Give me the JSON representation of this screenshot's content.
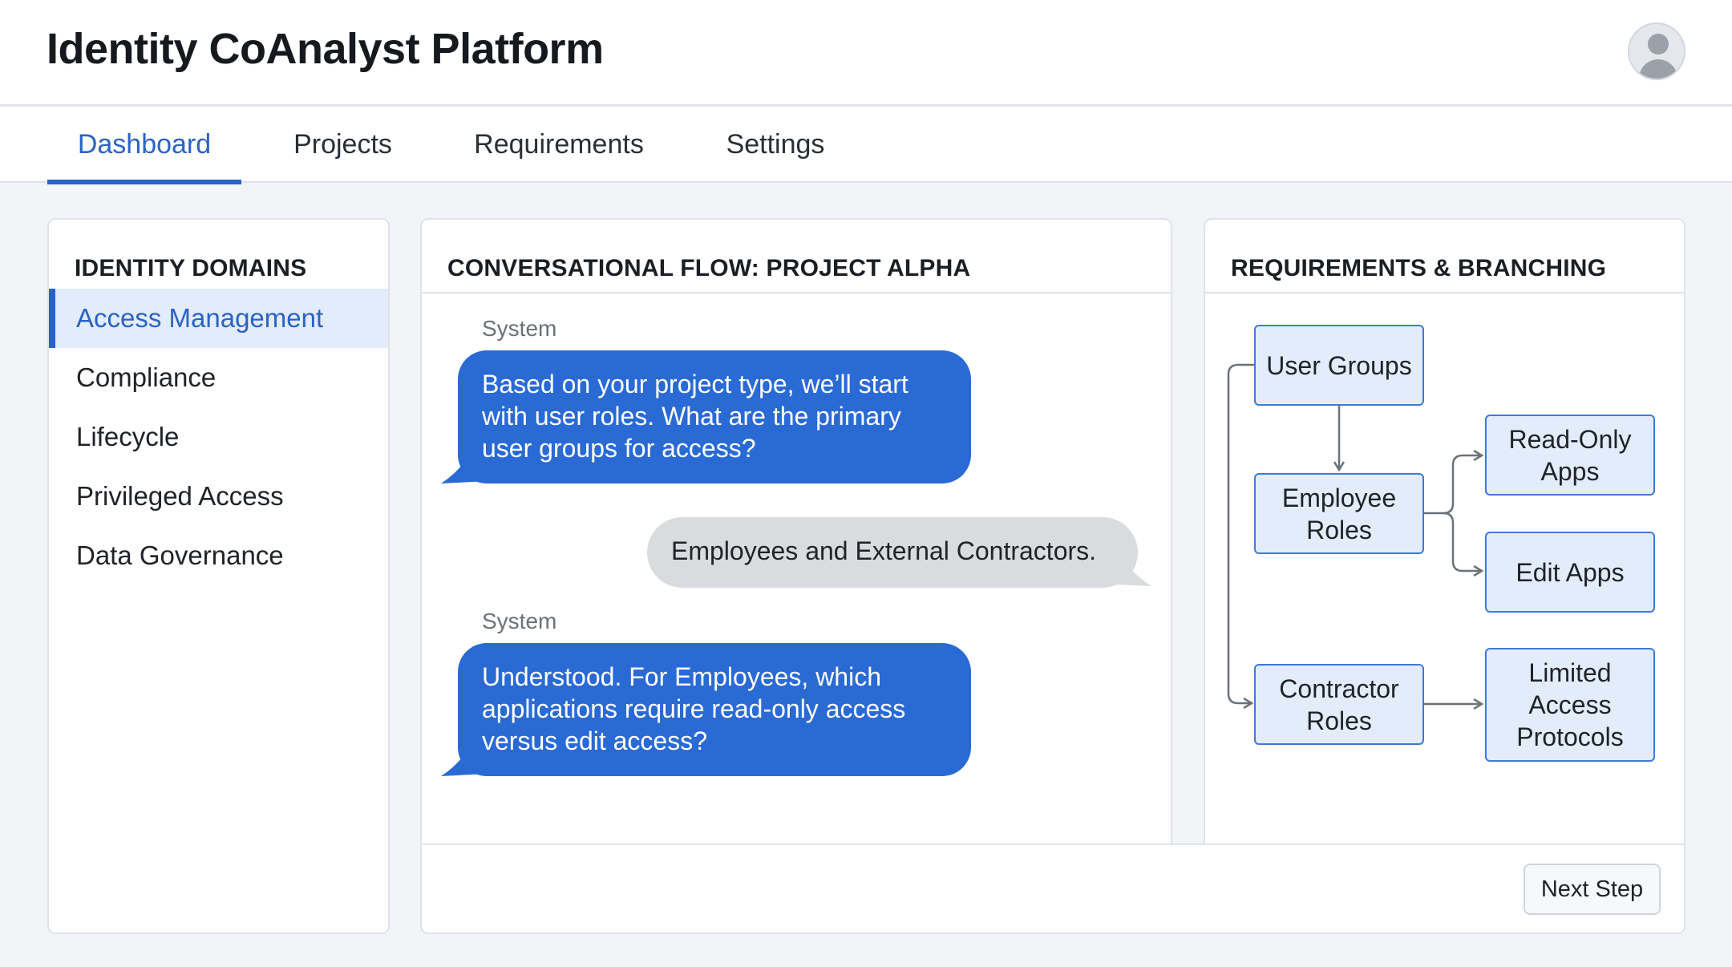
{
  "app": {
    "title": "Identity CoAnalyst Platform"
  },
  "tabs": [
    {
      "label": "Dashboard",
      "active": true
    },
    {
      "label": "Projects",
      "active": false
    },
    {
      "label": "Requirements",
      "active": false
    },
    {
      "label": "Settings",
      "active": false
    }
  ],
  "domains": {
    "title": "IDENTITY DOMAINS",
    "items": [
      {
        "label": "Access Management",
        "active": true
      },
      {
        "label": "Compliance",
        "active": false
      },
      {
        "label": "Lifecycle",
        "active": false
      },
      {
        "label": "Privileged Access",
        "active": false
      },
      {
        "label": "Data Governance",
        "active": false
      }
    ]
  },
  "flow": {
    "title": "CONVERSATIONAL FLOW: PROJECT ALPHA",
    "messages": [
      {
        "sender": "System",
        "text": "Based on your project type, we’ll start with user roles. What are the primary user groups for access?"
      },
      {
        "sender": "",
        "text": "Employees and External Contractors."
      },
      {
        "sender": "System",
        "text": "Understood. For Employees, which applications require read-only access versus edit access?"
      }
    ]
  },
  "requirements": {
    "title": "REQUIREMENTS & BRANCHING",
    "nodes": {
      "user_groups": "User Groups",
      "employee_roles": "Employee Roles",
      "contractor_roles": "Contractor Roles",
      "read_only_apps": "Read-Only Apps",
      "edit_apps": "Edit Apps",
      "limited_access": "Limited Access Protocols"
    }
  },
  "footer": {
    "next_label": "Next Step"
  },
  "colors": {
    "accent": "#2a63c6",
    "system_bubble": "#2a6ad4",
    "user_bubble": "#d9dbde",
    "node_fill": "#e3ecfa",
    "node_border": "#3f7ad6"
  },
  "icons": {
    "avatar": "user-avatar-icon"
  }
}
